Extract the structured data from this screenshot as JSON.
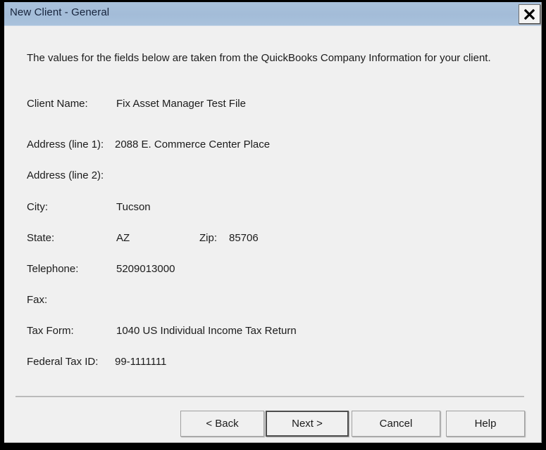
{
  "window": {
    "title": "New Client - General",
    "close_icon": "close-icon",
    "background_color": "#f0f0f0",
    "titlebar_color": "#a3bcd8"
  },
  "content": {
    "intro_text": "The values for the fields below are taken from the QuickBooks Company Information for your client.",
    "fields": [
      {
        "label": "Client Name:",
        "value": "Fix Asset Manager Test File"
      },
      {
        "label": "Address (line 1):",
        "value": "2088 E. Commerce Center Place"
      },
      {
        "label": "Address (line 2):",
        "value": ""
      },
      {
        "label": "City:",
        "value": "Tucson"
      },
      {
        "label": "State:",
        "value": "AZ"
      },
      {
        "label": "Telephone:",
        "value": "5209013000"
      },
      {
        "label": "Fax:",
        "value": ""
      },
      {
        "label": "Tax Form:",
        "value": "1040 US Individual Income Tax Return"
      },
      {
        "label": "Federal Tax ID:",
        "value": "99-1111111"
      }
    ],
    "zip": {
      "label": "Zip:",
      "value": "85706"
    }
  },
  "buttons": {
    "back": "< Back",
    "next": "Next >",
    "cancel": "Cancel",
    "help": "Help"
  }
}
